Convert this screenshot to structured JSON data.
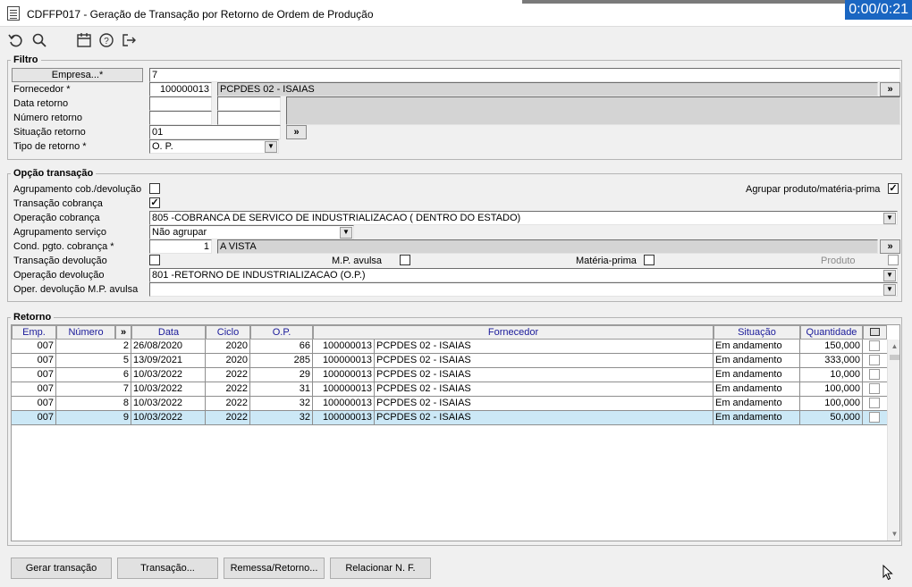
{
  "window": {
    "title": "CDFFP017 - Geração de Transação por Retorno de Ordem de Produção",
    "timer": "0:00/0:21"
  },
  "toolbar": {
    "icons": [
      "undo-icon",
      "search-icon",
      "calendar-icon",
      "help-icon",
      "exit-icon"
    ]
  },
  "filtro": {
    "legend": "Filtro",
    "empresa_button": "Empresa...*",
    "empresa_value": "7",
    "fornecedor_label": "Fornecedor *",
    "fornecedor_code": "100000013",
    "fornecedor_name": "PCPDES 02 - ISAIAS",
    "data_retorno_label": "Data retorno",
    "numero_retorno_label": "Número retorno",
    "situacao_label": "Situação retorno",
    "situacao_value": "01",
    "tipo_label": "Tipo de retorno *",
    "tipo_value": "O. P.",
    "more_button": "»"
  },
  "opcao": {
    "legend": "Opção transação",
    "agrupamento_cob_label": "Agrupamento cob./devolução",
    "agrupamento_cob_checked": false,
    "agrupar_produto_label": "Agrupar produto/matéria-prima",
    "agrupar_produto_checked": true,
    "transacao_cobranca_label": "Transação cobrança",
    "transacao_cobranca_checked": true,
    "operacao_cobranca_label": "Operação cobrança",
    "operacao_cobranca_value": "805 -COBRANCA DE SERVICO DE INDUSTRIALIZACAO ( DENTRO DO ESTADO)",
    "agrupamento_servico_label": "Agrupamento serviço",
    "agrupamento_servico_value": "Não agrupar",
    "cond_pgto_label": "Cond. pgto. cobrança *",
    "cond_pgto_code": "1",
    "cond_pgto_name": "A VISTA",
    "transacao_devolucao_label": "Transação devolução",
    "mp_avulsa_label": "M.P. avulsa",
    "materia_prima_label": "Matéria-prima",
    "produto_label": "Produto",
    "operacao_devolucao_label": "Operação devolução",
    "operacao_devolucao_value": "801 -RETORNO DE INDUSTRIALIZACAO (O.P.)",
    "oper_devolucao_mp_label": "Oper. devolução M.P. avulsa",
    "oper_devolucao_mp_value": ""
  },
  "retorno": {
    "legend": "Retorno",
    "columns": [
      "Emp.",
      "Número",
      "»",
      "Data",
      "Ciclo",
      "O.P.",
      "Fornecedor",
      "Situação",
      "Quantidade"
    ],
    "rows": [
      {
        "emp": "007",
        "numero": "2",
        "data": "26/08/2020",
        "ciclo": "2020",
        "op": "66",
        "forn_code": "100000013",
        "forn_name": "PCPDES 02 - ISAIAS",
        "situacao": "Em andamento",
        "quantidade": "150,000",
        "checked": false
      },
      {
        "emp": "007",
        "numero": "5",
        "data": "13/09/2021",
        "ciclo": "2020",
        "op": "285",
        "forn_code": "100000013",
        "forn_name": "PCPDES 02 - ISAIAS",
        "situacao": "Em andamento",
        "quantidade": "333,000",
        "checked": false
      },
      {
        "emp": "007",
        "numero": "6",
        "data": "10/03/2022",
        "ciclo": "2022",
        "op": "29",
        "forn_code": "100000013",
        "forn_name": "PCPDES 02 - ISAIAS",
        "situacao": "Em andamento",
        "quantidade": "10,000",
        "checked": false
      },
      {
        "emp": "007",
        "numero": "7",
        "data": "10/03/2022",
        "ciclo": "2022",
        "op": "31",
        "forn_code": "100000013",
        "forn_name": "PCPDES 02 - ISAIAS",
        "situacao": "Em andamento",
        "quantidade": "100,000",
        "checked": false
      },
      {
        "emp": "007",
        "numero": "8",
        "data": "10/03/2022",
        "ciclo": "2022",
        "op": "32",
        "forn_code": "100000013",
        "forn_name": "PCPDES 02 - ISAIAS",
        "situacao": "Em andamento",
        "quantidade": "100,000",
        "checked": false
      },
      {
        "emp": "007",
        "numero": "9",
        "data": "10/03/2022",
        "ciclo": "2022",
        "op": "32",
        "forn_code": "100000013",
        "forn_name": "PCPDES 02 - ISAIAS",
        "situacao": "Em andamento",
        "quantidade": "50,000",
        "checked": false,
        "selected": true
      }
    ]
  },
  "footer": {
    "gerar": "Gerar transação",
    "transacao": "Transação...",
    "remessa": "Remessa/Retorno...",
    "relacionar": "Relacionar N. F."
  },
  "colors": {
    "selected_row": "#cce8f6",
    "header_text": "#1a1a9a",
    "timer_bg": "#1a66c2"
  }
}
